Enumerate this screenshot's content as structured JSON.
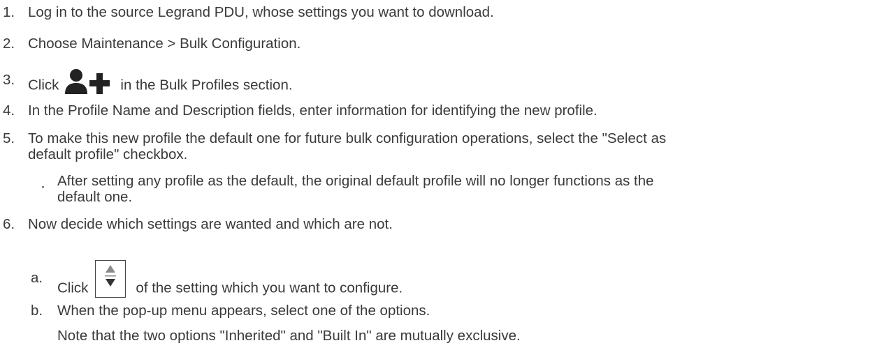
{
  "steps": [
    {
      "num": "1.",
      "text": "Log in to the source Legrand PDU, whose settings you want to download."
    },
    {
      "num": "2.",
      "text": "Choose Maintenance > Bulk Configuration."
    },
    {
      "num": "3.",
      "text_before": "Click",
      "text_after": "in the Bulk Profiles section."
    },
    {
      "num": "4.",
      "text": "In the Profile Name and Description fields, enter information for identifying the new profile."
    },
    {
      "num": "5.",
      "line1": "To make this new profile the default one for future bulk configuration operations, select the \"Select as",
      "line2": "default profile\" checkbox."
    },
    {
      "num": "6.",
      "text": "Now decide which settings are wanted and which are not."
    }
  ],
  "step5_bullet": {
    "marker": "▪",
    "line1": "After setting any profile as the default, the original default profile will no longer functions as the",
    "line2": "default one."
  },
  "substeps": [
    {
      "letter": "a.",
      "text_before": "Click",
      "text_after": "of the setting which you want to configure."
    },
    {
      "letter": "b.",
      "text": "When the pop-up menu appears, select one of the options."
    }
  ],
  "note": "Note that the two options \"Inherited\" and \"Built In\" are mutually exclusive.",
  "icons": {
    "add_profile": "add-profile-icon",
    "spinner": "up-down-spinner-icon"
  }
}
